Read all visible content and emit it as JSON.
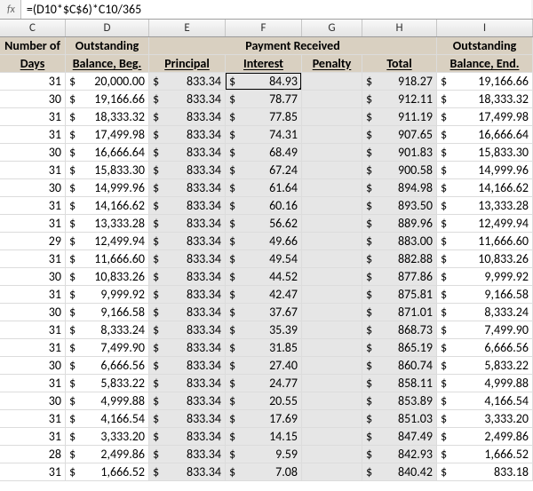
{
  "formula_bar": {
    "fx_label": "fx",
    "formula": "=(D10*$C$6)*C10/365"
  },
  "columns": [
    "C",
    "D",
    "E",
    "F",
    "G",
    "H",
    "I"
  ],
  "headers": {
    "number_of": "Number of",
    "days": "Days",
    "outstanding_beg_top": "Outstanding",
    "outstanding_beg_bot": "Balance, Beg.",
    "payment_received": "Payment Received",
    "principal": "Principal",
    "interest": "Interest",
    "penalty": "Penalty",
    "total": "Total",
    "outstanding_end_top": "Outstanding",
    "outstanding_end_bot": "Balance, End."
  },
  "rows": [
    {
      "days": "31",
      "beg": "20,000.00",
      "principal": "833.34",
      "interest": "84.93",
      "penalty": "",
      "total": "918.27",
      "end": "19,166.66"
    },
    {
      "days": "30",
      "beg": "19,166.66",
      "principal": "833.34",
      "interest": "78.77",
      "penalty": "",
      "total": "912.11",
      "end": "18,333.32"
    },
    {
      "days": "31",
      "beg": "18,333.32",
      "principal": "833.34",
      "interest": "77.85",
      "penalty": "",
      "total": "911.19",
      "end": "17,499.98"
    },
    {
      "days": "31",
      "beg": "17,499.98",
      "principal": "833.34",
      "interest": "74.31",
      "penalty": "",
      "total": "907.65",
      "end": "16,666.64"
    },
    {
      "days": "30",
      "beg": "16,666.64",
      "principal": "833.34",
      "interest": "68.49",
      "penalty": "",
      "total": "901.83",
      "end": "15,833.30"
    },
    {
      "days": "31",
      "beg": "15,833.30",
      "principal": "833.34",
      "interest": "67.24",
      "penalty": "",
      "total": "900.58",
      "end": "14,999.96"
    },
    {
      "days": "30",
      "beg": "14,999.96",
      "principal": "833.34",
      "interest": "61.64",
      "penalty": "",
      "total": "894.98",
      "end": "14,166.62"
    },
    {
      "days": "31",
      "beg": "14,166.62",
      "principal": "833.34",
      "interest": "60.16",
      "penalty": "",
      "total": "893.50",
      "end": "13,333.28"
    },
    {
      "days": "31",
      "beg": "13,333.28",
      "principal": "833.34",
      "interest": "56.62",
      "penalty": "",
      "total": "889.96",
      "end": "12,499.94"
    },
    {
      "days": "29",
      "beg": "12,499.94",
      "principal": "833.34",
      "interest": "49.66",
      "penalty": "",
      "total": "883.00",
      "end": "11,666.60"
    },
    {
      "days": "31",
      "beg": "11,666.60",
      "principal": "833.34",
      "interest": "49.54",
      "penalty": "",
      "total": "882.88",
      "end": "10,833.26"
    },
    {
      "days": "30",
      "beg": "10,833.26",
      "principal": "833.34",
      "interest": "44.52",
      "penalty": "",
      "total": "877.86",
      "end": "9,999.92"
    },
    {
      "days": "31",
      "beg": "9,999.92",
      "principal": "833.34",
      "interest": "42.47",
      "penalty": "",
      "total": "875.81",
      "end": "9,166.58"
    },
    {
      "days": "30",
      "beg": "9,166.58",
      "principal": "833.34",
      "interest": "37.67",
      "penalty": "",
      "total": "871.01",
      "end": "8,333.24"
    },
    {
      "days": "31",
      "beg": "8,333.24",
      "principal": "833.34",
      "interest": "35.39",
      "penalty": "",
      "total": "868.73",
      "end": "7,499.90"
    },
    {
      "days": "31",
      "beg": "7,499.90",
      "principal": "833.34",
      "interest": "31.85",
      "penalty": "",
      "total": "865.19",
      "end": "6,666.56"
    },
    {
      "days": "30",
      "beg": "6,666.56",
      "principal": "833.34",
      "interest": "27.40",
      "penalty": "",
      "total": "860.74",
      "end": "5,833.22"
    },
    {
      "days": "31",
      "beg": "5,833.22",
      "principal": "833.34",
      "interest": "24.77",
      "penalty": "",
      "total": "858.11",
      "end": "4,999.88"
    },
    {
      "days": "30",
      "beg": "4,999.88",
      "principal": "833.34",
      "interest": "20.55",
      "penalty": "",
      "total": "853.89",
      "end": "4,166.54"
    },
    {
      "days": "31",
      "beg": "4,166.54",
      "principal": "833.34",
      "interest": "17.69",
      "penalty": "",
      "total": "851.03",
      "end": "3,333.20"
    },
    {
      "days": "31",
      "beg": "3,333.20",
      "principal": "833.34",
      "interest": "14.15",
      "penalty": "",
      "total": "847.49",
      "end": "2,499.86"
    },
    {
      "days": "28",
      "beg": "2,499.86",
      "principal": "833.34",
      "interest": "9.59",
      "penalty": "",
      "total": "842.93",
      "end": "1,666.52"
    },
    {
      "days": "31",
      "beg": "1,666.52",
      "principal": "833.34",
      "interest": "7.08",
      "penalty": "",
      "total": "840.42",
      "end": "833.18"
    }
  ],
  "currency_symbol": "$",
  "chart_data": {
    "type": "table",
    "title": "Amortization schedule excerpt",
    "columns": [
      "Number of Days",
      "Outstanding Balance, Beg.",
      "Principal",
      "Interest",
      "Penalty",
      "Total",
      "Outstanding Balance, End."
    ],
    "rows": [
      [
        31,
        20000.0,
        833.34,
        84.93,
        null,
        918.27,
        19166.66
      ],
      [
        30,
        19166.66,
        833.34,
        78.77,
        null,
        912.11,
        18333.32
      ],
      [
        31,
        18333.32,
        833.34,
        77.85,
        null,
        911.19,
        17499.98
      ],
      [
        31,
        17499.98,
        833.34,
        74.31,
        null,
        907.65,
        16666.64
      ],
      [
        30,
        16666.64,
        833.34,
        68.49,
        null,
        901.83,
        15833.3
      ],
      [
        31,
        15833.3,
        833.34,
        67.24,
        null,
        900.58,
        14999.96
      ],
      [
        30,
        14999.96,
        833.34,
        61.64,
        null,
        894.98,
        14166.62
      ],
      [
        31,
        14166.62,
        833.34,
        60.16,
        null,
        893.5,
        13333.28
      ],
      [
        31,
        13333.28,
        833.34,
        56.62,
        null,
        889.96,
        12499.94
      ],
      [
        29,
        12499.94,
        833.34,
        49.66,
        null,
        883.0,
        11666.6
      ],
      [
        31,
        11666.6,
        833.34,
        49.54,
        null,
        882.88,
        10833.26
      ],
      [
        30,
        10833.26,
        833.34,
        44.52,
        null,
        877.86,
        9999.92
      ],
      [
        31,
        9999.92,
        833.34,
        42.47,
        null,
        875.81,
        9166.58
      ],
      [
        30,
        9166.58,
        833.34,
        37.67,
        null,
        871.01,
        8333.24
      ],
      [
        31,
        8333.24,
        833.34,
        35.39,
        null,
        868.73,
        7499.9
      ],
      [
        31,
        7499.9,
        833.34,
        31.85,
        null,
        865.19,
        6666.56
      ],
      [
        30,
        6666.56,
        833.34,
        27.4,
        null,
        860.74,
        5833.22
      ],
      [
        31,
        5833.22,
        833.34,
        24.77,
        null,
        858.11,
        4999.88
      ],
      [
        30,
        4999.88,
        833.34,
        20.55,
        null,
        853.89,
        4166.54
      ],
      [
        31,
        4166.54,
        833.34,
        17.69,
        null,
        851.03,
        3333.2
      ],
      [
        31,
        3333.2,
        833.34,
        14.15,
        null,
        847.49,
        2499.86
      ],
      [
        28,
        2499.86,
        833.34,
        9.59,
        null,
        842.93,
        1666.52
      ],
      [
        31,
        1666.52,
        833.34,
        7.08,
        null,
        840.42,
        833.18
      ]
    ]
  }
}
